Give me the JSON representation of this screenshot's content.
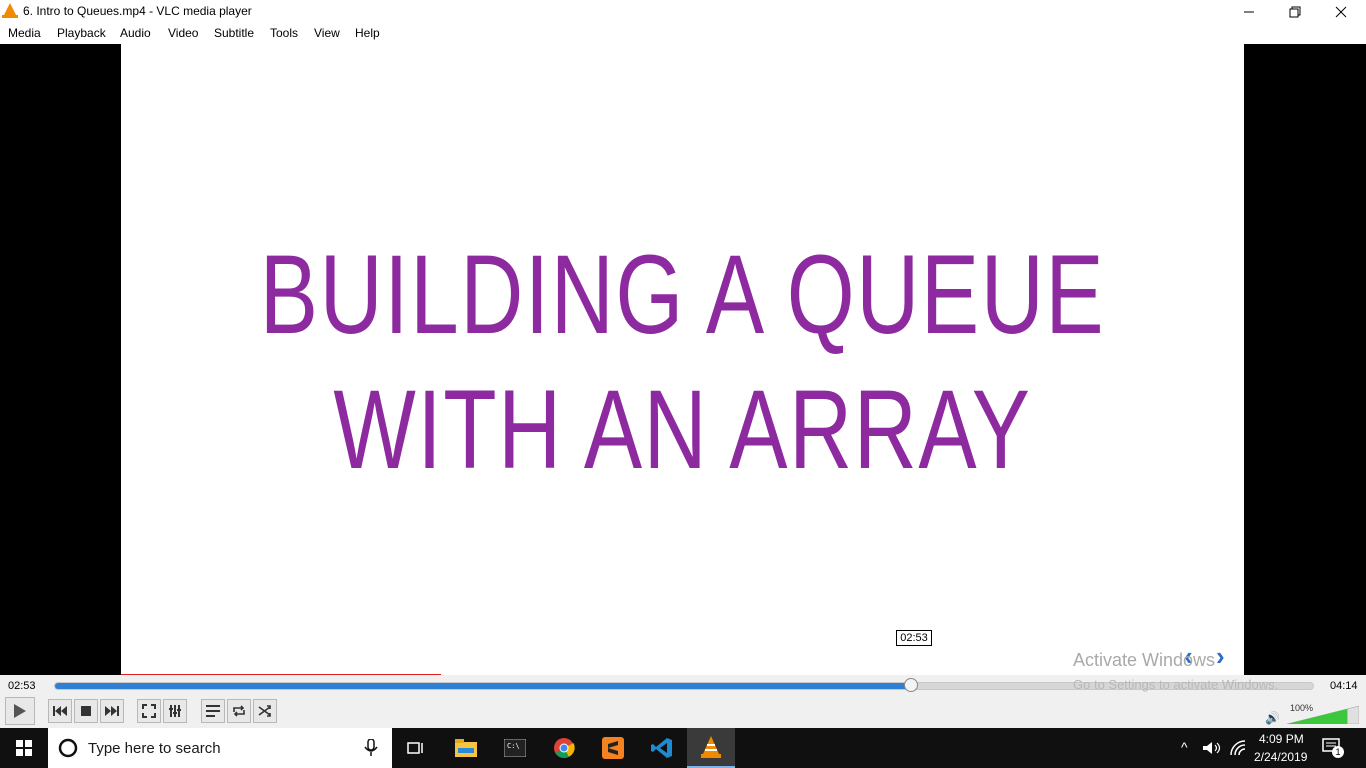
{
  "window": {
    "title": "6. Intro to Queues.mp4 - VLC media player",
    "minimize_icon": "minimize-icon",
    "restore_icon": "restore-icon",
    "close_icon": "close-icon"
  },
  "menu": [
    "Media",
    "Playback",
    "Audio",
    "Video",
    "Subtitle",
    "Tools",
    "View",
    "Help"
  ],
  "slide": {
    "line1": "BUILDING A QUEUE",
    "line2": "WITH AN ARRAY",
    "text_color": "#8e2aa0"
  },
  "player": {
    "elapsed": "02:53",
    "total": "04:14",
    "hover_tooltip": "02:53",
    "seek_fraction": 0.681,
    "volume_label": "100%",
    "volume_fraction": 1.0,
    "accent_color": "#2f7fd3"
  },
  "watermark": {
    "line1": "Activate Windows",
    "line2": "Go to Settings to activate Windows."
  },
  "taskbar": {
    "search_placeholder": "Type here to search",
    "time": "4:09 PM",
    "date": "2/24/2019",
    "notification_count": "1"
  }
}
